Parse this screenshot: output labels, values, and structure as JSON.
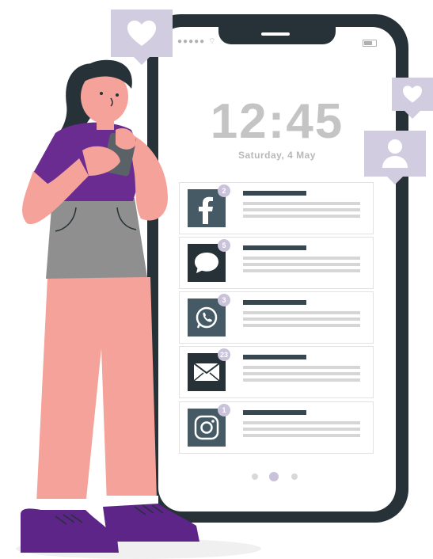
{
  "phone": {
    "time": "12:45",
    "date": "Saturday, 4 May"
  },
  "notifications": [
    {
      "app": "facebook",
      "icon": "facebook-icon",
      "count": "2"
    },
    {
      "app": "messages",
      "icon": "chat-bubble-icon",
      "count": "5"
    },
    {
      "app": "whatsapp",
      "icon": "whatsapp-icon",
      "count": "3"
    },
    {
      "app": "mail",
      "icon": "mail-icon",
      "count": "23"
    },
    {
      "app": "instagram",
      "icon": "instagram-icon",
      "count": "1"
    }
  ],
  "floating_icons": [
    "heart-icon",
    "heart-icon",
    "user-icon"
  ],
  "colors": {
    "phone_frame": "#263238",
    "accent_lavender": "#d1cce0",
    "skin": "#f4a29a",
    "shirt": "#6a2c91",
    "shoes": "#5c2587",
    "shorts": "#8f8f8f"
  }
}
